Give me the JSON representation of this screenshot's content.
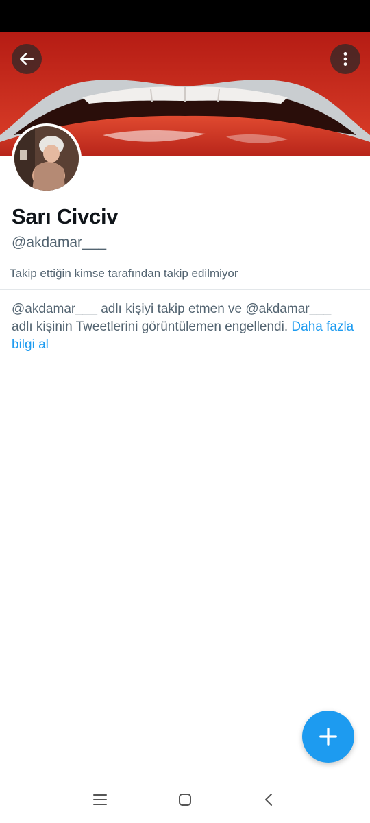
{
  "profile": {
    "display_name": "Sarı Civciv",
    "handle": "@akdamar___",
    "follow_note": "Takip ettiğin kimse tarafından takip edilmiyor"
  },
  "blocked_notice": {
    "message": "@akdamar___ adlı kişiyi takip etmen ve @akdamar___ adlı kişinin Tweetlerini görüntülemen engellendi. ",
    "link": "Daha fazla bilgi al"
  },
  "icons": {
    "back": "arrow-left-icon",
    "more": "more-vertical-icon",
    "compose": "plus-icon",
    "nav_recent": "menu-lines-icon",
    "nav_home": "square-home-icon",
    "nav_back": "chevron-left-icon"
  },
  "colors": {
    "accent": "#1d9bf0",
    "text_primary": "#0f1419",
    "text_secondary": "#536471",
    "lip_red": "#c8281e"
  }
}
